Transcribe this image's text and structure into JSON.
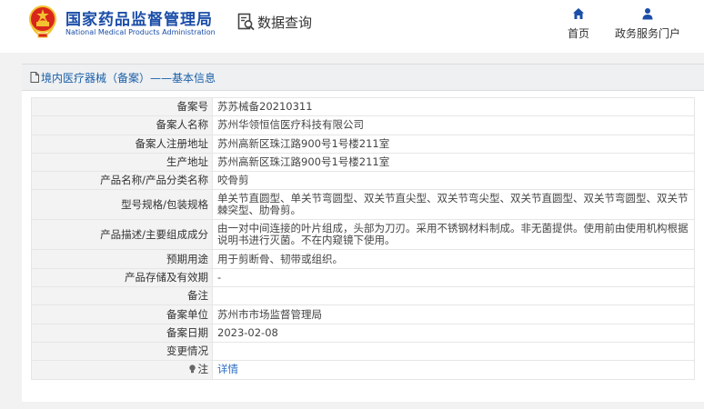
{
  "header": {
    "title_zh": "国家药品监督管理局",
    "title_en": "National Medical Products Administration",
    "query_label": "数据查询",
    "nav": [
      {
        "label": "首页",
        "icon": "home-icon"
      },
      {
        "label": "政务服务门户",
        "icon": "user-icon"
      }
    ]
  },
  "panel": {
    "title": "境内医疗器械（备案）——基本信息"
  },
  "rows": [
    {
      "label": "备案号",
      "value": "苏苏械备20210311"
    },
    {
      "label": "备案人名称",
      "value": "苏州华领恒信医疗科技有限公司"
    },
    {
      "label": "备案人注册地址",
      "value": "苏州高新区珠江路900号1号楼211室"
    },
    {
      "label": "生产地址",
      "value": "苏州高新区珠江路900号1号楼211室"
    },
    {
      "label": "产品名称/产品分类名称",
      "value": "咬骨剪"
    },
    {
      "label": "型号规格/包装规格",
      "value": "单关节直圆型、单关节弯圆型、双关节直尖型、双关节弯尖型、双关节直圆型、双关节弯圆型、双关节棘突型、肋骨剪。"
    },
    {
      "label": "产品描述/主要组成成分",
      "value": "由一对中间连接的叶片组成，头部为刀刃。采用不锈钢材料制成。非无菌提供。使用前由使用机构根据说明书进行灭菌。不在内窥镜下使用。"
    },
    {
      "label": "预期用途",
      "value": "用于剪断骨、韧带或组织。"
    },
    {
      "label": "产品存储及有效期",
      "value": "-"
    },
    {
      "label": "备注",
      "value": ""
    },
    {
      "label": "备案单位",
      "value": "苏州市市场监督管理局"
    },
    {
      "label": "备案日期",
      "value": "2023-02-08"
    },
    {
      "label": "变更情况",
      "value": ""
    },
    {
      "label": "注",
      "value": "详情"
    }
  ],
  "colors": {
    "brand_blue": "#1b4ea8",
    "link_blue": "#2a6cc4",
    "emblem_red": "#d9261c",
    "emblem_gold": "#f3c230"
  }
}
